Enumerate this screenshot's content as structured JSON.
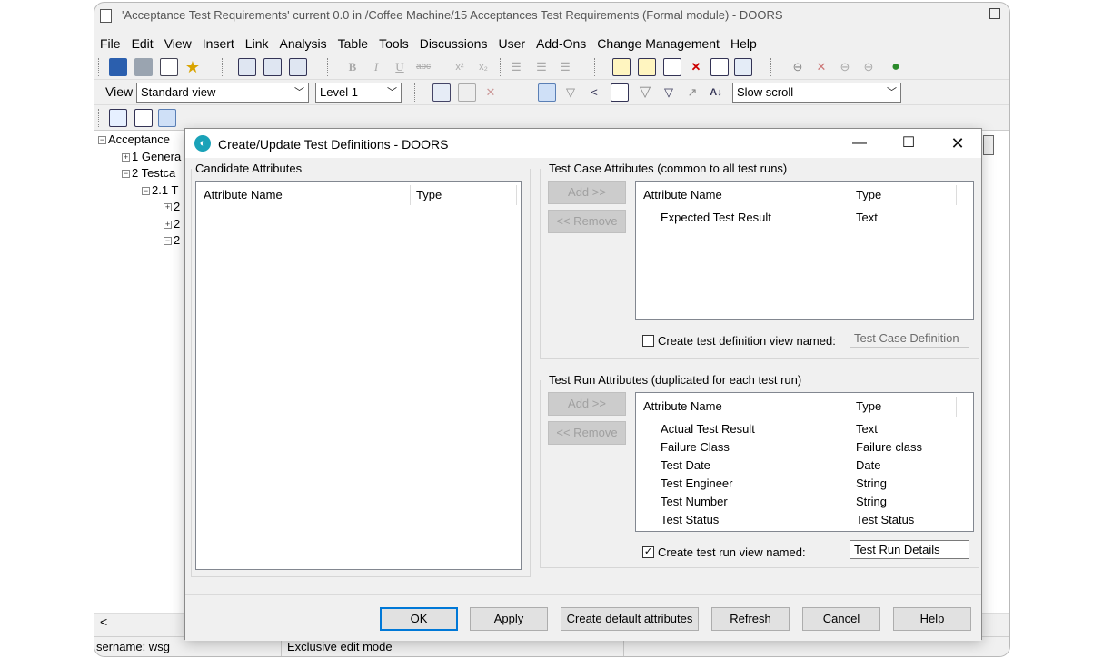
{
  "main_window": {
    "title": "'Acceptance Test Requirements' current 0.0 in /Coffee Machine/15 Acceptances Test Requirements (Formal module) - DOORS",
    "menu": [
      "File",
      "Edit",
      "View",
      "Insert",
      "Link",
      "Analysis",
      "Table",
      "Tools",
      "Discussions",
      "User",
      "Add-Ons",
      "Change Management",
      "Help"
    ],
    "toolbar2": {
      "view_label": "View",
      "view_value": "Standard view",
      "level_value": "Level 1",
      "scroll_value": "Slow scroll"
    },
    "tree": {
      "root": "Acceptance",
      "items": [
        "1 Genera",
        "2 Testca",
        "2.1 T",
        "2",
        "2",
        "2"
      ]
    },
    "status": {
      "username": "sername: wsg",
      "mode": "Exclusive edit mode"
    }
  },
  "dialog": {
    "title": "Create/Update Test Definitions - DOORS",
    "candidate": {
      "group_label": "Candidate Attributes",
      "col_name": "Attribute Name",
      "col_type": "Type"
    },
    "test_case": {
      "group_label": "Test Case Attributes (common to all test runs)",
      "add_label": "Add >>",
      "remove_label": "<< Remove",
      "col_name": "Attribute Name",
      "col_type": "Type",
      "rows": [
        {
          "name": "Expected Test Result",
          "type": "Text"
        }
      ],
      "checkbox_label": "Create test definition view named:",
      "checkbox_checked": false,
      "view_name": "Test Case Definition"
    },
    "test_run": {
      "group_label": "Test Run Attributes (duplicated for each test run)",
      "add_label": "Add >>",
      "remove_label": "<< Remove",
      "col_name": "Attribute Name",
      "col_type": "Type",
      "rows": [
        {
          "name": "Actual Test Result",
          "type": "Text"
        },
        {
          "name": "Failure Class",
          "type": "Failure class"
        },
        {
          "name": "Test Date",
          "type": "Date"
        },
        {
          "name": "Test Engineer",
          "type": "String"
        },
        {
          "name": "Test Number",
          "type": "String"
        },
        {
          "name": "Test Status",
          "type": "Test Status"
        }
      ],
      "checkbox_label": "Create test run view named:",
      "checkbox_checked": true,
      "view_name": "Test Run Details"
    },
    "buttons": {
      "ok": "OK",
      "apply": "Apply",
      "create_default": "Create default attributes",
      "refresh": "Refresh",
      "cancel": "Cancel",
      "help": "Help"
    },
    "check_mark": "✓"
  },
  "colors": {
    "accent": "#0078d7",
    "logo": "#1aa2b8"
  }
}
